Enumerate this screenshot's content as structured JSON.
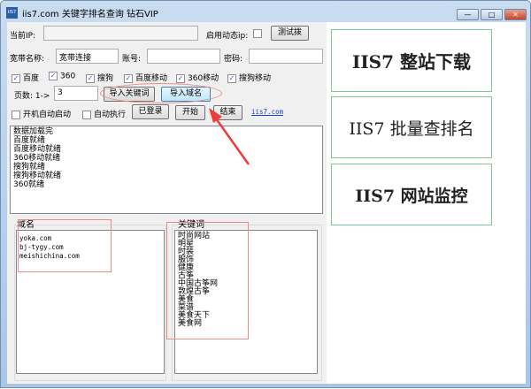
{
  "window": {
    "title": "iis7.com 关键字排名查询 钻石VIP",
    "icon": "app-icon",
    "controls": {
      "minimize": "—",
      "maximize": "□",
      "close": "✕"
    }
  },
  "row1": {
    "ip_label": "当前IP:",
    "ip_value": "",
    "dynamic_ip_label": "启用动态ip:",
    "dynamic_ip_checked": false,
    "test_dial_button": "测试拨"
  },
  "row2": {
    "broadband_label": "宽带名称:",
    "broadband_value": "宽带连接",
    "account_label": "账号:",
    "account_value": "",
    "password_label": "密码:",
    "password_value": ""
  },
  "engines": [
    {
      "label": "百度",
      "checked": true
    },
    {
      "label": "360",
      "checked": true
    },
    {
      "label": "搜狗",
      "checked": true
    },
    {
      "label": "百度移动",
      "checked": true
    },
    {
      "label": "360移动",
      "checked": true
    },
    {
      "label": "搜狗移动",
      "checked": true
    }
  ],
  "row4": {
    "pages_label": "页数: 1->",
    "pages_value": "3",
    "import_keywords_button": "导入关键词",
    "import_domains_button": "导入域名"
  },
  "row5": {
    "autostart_label": "开机自动启动",
    "autostart_checked": false,
    "autorun_label": "自动执行",
    "autorun_checked": false,
    "logged_in_button": "已登录",
    "start_button": "开始",
    "stop_button": "结束",
    "link": "iis7.com"
  },
  "log": [
    "数据加载完",
    "百度就绪",
    "百度移动就绪",
    "360移动就绪",
    "搜狗就绪",
    "搜狗移动就绪",
    "360就绪"
  ],
  "domains": {
    "label": "域名",
    "items": [
      "yoka.com",
      "bj-tygy.com",
      "meishichina.com"
    ]
  },
  "keywords": {
    "label": "关键词",
    "items": [
      "时尚网站",
      "明星",
      "时装",
      "服饰",
      "健康",
      "古筝",
      "中国古筝网",
      "敦煌古筝",
      "美食",
      "菜谱",
      "美食天下",
      "美食网"
    ]
  },
  "ads": [
    "IIS7 整站下载",
    "IIS7 批量查排名",
    "IIS7 网站监控"
  ],
  "colors": {
    "annotation_red": "#ee3b3b",
    "ad_border": "#7fc79a",
    "link": "#1a3fc4"
  }
}
